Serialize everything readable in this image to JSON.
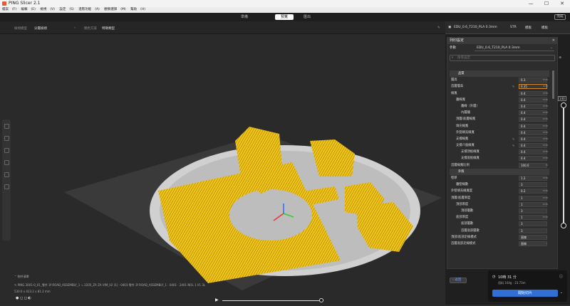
{
  "app": {
    "title": "PING Slicer 2.1",
    "menu": [
      "檔案",
      "(F)",
      "編輯",
      "(E)",
      "檢視",
      "(V)",
      "設定",
      "(S)",
      "進階功能",
      "(A)",
      "觀察選擇",
      "(M)",
      "幫助",
      "(H)"
    ]
  },
  "window_buttons": [
    "—",
    "☐",
    "✕"
  ],
  "tabs": [
    {
      "label": "準備"
    },
    {
      "label": "預覽"
    },
    {
      "label": "匯出"
    }
  ],
  "top_right_button": "完成",
  "subbar": {
    "view_label": "檢視模型",
    "view_value": "分層檢視",
    "color_label": "顏色方案",
    "color_value": "特徵類型"
  },
  "profile": {
    "name": "EDU_0.6_T210_PLA  0.3mm",
    "badge1": "STR",
    "badge2": "模板",
    "badge3": "模板"
  },
  "settings": {
    "header": "列印設定",
    "preset_label": "參數",
    "preset_value": "EDU_0.6_T210_PLA  0.3mm",
    "search_placeholder": "搜尋設定",
    "back_label": "返回",
    "rows": [
      {
        "type": "section",
        "name": "品質"
      },
      {
        "name": "層高",
        "value": "0.3",
        "unit": "mm",
        "indent": 0
      },
      {
        "name": "首層層高",
        "value": "0.35",
        "unit": "mm",
        "indent": 0,
        "highlight": true,
        "icon": "✎"
      },
      {
        "name": "線寬",
        "value": "0.4",
        "unit": "mm",
        "indent": 0
      },
      {
        "name": "牆線寬",
        "value": "0.4",
        "unit": "mm",
        "indent": 1
      },
      {
        "name": "牆線（外層）",
        "value": "0.4",
        "unit": "mm",
        "indent": 2
      },
      {
        "name": "內層牆",
        "value": "0.4",
        "unit": "mm",
        "indent": 2
      },
      {
        "name": "頂層/底層線寬",
        "value": "0.4",
        "unit": "mm",
        "indent": 1
      },
      {
        "name": "填充線寬",
        "value": "0.4",
        "unit": "mm",
        "indent": 1
      },
      {
        "name": "外圍填充線寬",
        "value": "0.4",
        "unit": "mm",
        "indent": 1
      },
      {
        "name": "支撐線寬",
        "value": "0.4",
        "unit": "mm",
        "indent": 1,
        "icon": "✎"
      },
      {
        "name": "支撐介面線寬",
        "value": "0.4",
        "unit": "mm",
        "indent": 1,
        "icon": "✎"
      },
      {
        "name": "支撐頂板線寬",
        "value": "0.4",
        "unit": "mm",
        "indent": 2
      },
      {
        "name": "支撐底板線寬",
        "value": "0.4",
        "unit": "mm",
        "indent": 2
      },
      {
        "name": "首層線寬比例",
        "value": "100.0",
        "unit": "%",
        "indent": 0
      },
      {
        "type": "section",
        "name": "外殼"
      },
      {
        "name": "壁厚",
        "value": "1.2",
        "unit": "mm",
        "indent": 0
      },
      {
        "name": "牆壁線數",
        "value": "3",
        "unit": "",
        "indent": 1
      },
      {
        "name": "外壁填充線寬度",
        "value": "0.2",
        "unit": "mm",
        "indent": 0
      },
      {
        "name": "頂層/底層厚度",
        "value": "1",
        "unit": "mm",
        "indent": 0
      },
      {
        "name": "頂部厚度",
        "value": "1",
        "unit": "mm",
        "indent": 1
      },
      {
        "name": "頂部層數",
        "value": "3",
        "unit": "",
        "indent": 2
      },
      {
        "name": "底部厚度",
        "value": "1",
        "unit": "mm",
        "indent": 1
      },
      {
        "name": "底部層數",
        "value": "3",
        "unit": "",
        "indent": 2
      },
      {
        "name": "首層底部層數",
        "value": "3",
        "unit": "",
        "indent": 2
      },
      {
        "name": "頂部/底部走線模式",
        "value": "直線",
        "unit": "⌄",
        "indent": 0
      },
      {
        "name": "首層底部走線模式",
        "value": "直線",
        "unit": "⌄",
        "indent": 0
      }
    ]
  },
  "slider": {
    "top_label": "140"
  },
  "slice_info": {
    "time": "10時 31 分",
    "material": "用料 164g · 23.73m",
    "button": "開始切片"
  },
  "bottom_info": {
    "objects_label": "物件清單",
    "filename": "PING 3001-0_01_零件 3f ROAD_ASSEMBLY_1 ↘ 2205_ZA ZA VIM_V2 (1) · 0403 零件 3f ROAD_ASSEMBLY_1 · 0401 · 2401 NOL 1 V1 3L",
    "size": "530.0 x 413.2 x 81.2 mm"
  },
  "colors": {
    "accent": "#2f6fd6",
    "print": "#f0c419",
    "bed": "#cfcfcf"
  }
}
